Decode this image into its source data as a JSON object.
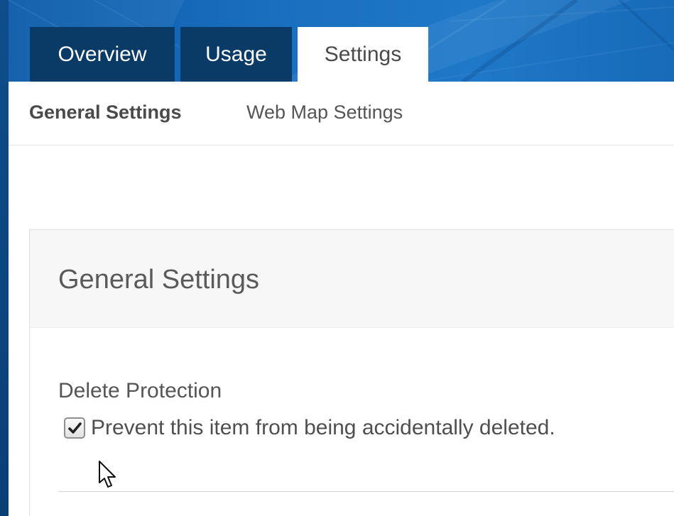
{
  "tabs": [
    {
      "label": "Overview",
      "active": false
    },
    {
      "label": "Usage",
      "active": false
    },
    {
      "label": "Settings",
      "active": true
    }
  ],
  "subnav": {
    "items": [
      {
        "label": "General Settings",
        "active": true
      },
      {
        "label": "Web Map Settings",
        "active": false
      }
    ]
  },
  "panel": {
    "title": "General Settings",
    "delete_protection": {
      "label": "Delete Protection",
      "checkbox_label": "Prevent this item from being accidentally deleted.",
      "checked": true
    }
  },
  "icons": {
    "checkbox_check": "checkmark-icon",
    "mouse_cursor": "mouse-pointer-icon"
  },
  "colors": {
    "header_blue": "#1a6fbf",
    "tab_dark": "#0a3a66",
    "tab_active_bg": "#ffffff",
    "text_gray": "#4c4c4c"
  }
}
